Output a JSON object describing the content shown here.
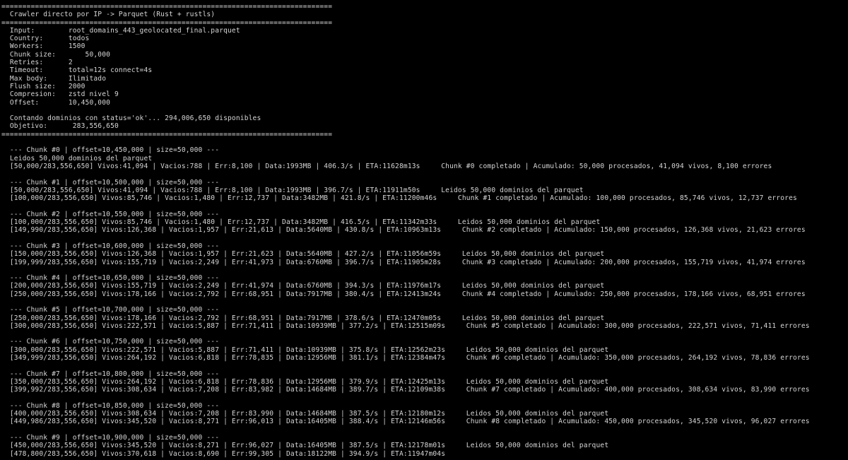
{
  "terminal": {
    "lines": [
      "===============================================================================",
      "  Crawler directo por IP -> Parquet (Rust + rustls)",
      "===============================================================================",
      "  Input:        root_domains_443_geolocated_final.parquet",
      "  Country:      todos",
      "  Workers:      1500",
      "  Chunk size:       50,000",
      "  Retries:      2",
      "  Timeout:      total=12s connect=4s",
      "  Max body:     Ilimitado",
      "  Flush size:   2000",
      "  Compresion:   zstd nivel 9",
      "  Offset:       10,450,000",
      "",
      "  Contando dominios con status='ok'... 294,006,650 disponibles",
      "  Objetivo:      283,556,650",
      "===============================================================================",
      "",
      "  --- Chunk #0 | offset=10,450,000 | size=50,000 ---",
      "  Leidos 50,000 dominios del parquet",
      "  [50,000/283,556,650] Vivos:41,094 | Vacios:788 | Err:8,100 | Data:1993MB | 406.3/s | ETA:11628m13s     Chunk #0 completado | Acumulado: 50,000 procesados, 41,094 vivos, 8,100 errores",
      "",
      "  --- Chunk #1 | offset=10,500,000 | size=50,000 ---",
      "  [50,000/283,556,650] Vivos:41,094 | Vacios:788 | Err:8,100 | Data:1993MB | 396.7/s | ETA:11911m50s     Leidos 50,000 dominios del parquet",
      "  [100,000/283,556,650] Vivos:85,746 | Vacios:1,480 | Err:12,737 | Data:3482MB | 421.8/s | ETA:11200m46s     Chunk #1 completado | Acumulado: 100,000 procesados, 85,746 vivos, 12,737 errores",
      "",
      "  --- Chunk #2 | offset=10,550,000 | size=50,000 ---",
      "  [100,000/283,556,650] Vivos:85,746 | Vacios:1,480 | Err:12,737 | Data:3482MB | 416.5/s | ETA:11342m33s     Leidos 50,000 dominios del parquet",
      "  [149,990/283,556,650] Vivos:126,368 | Vacios:1,957 | Err:21,613 | Data:5640MB | 430.8/s | ETA:10963m13s     Chunk #2 completado | Acumulado: 150,000 procesados, 126,368 vivos, 21,623 errores",
      "",
      "  --- Chunk #3 | offset=10,600,000 | size=50,000 ---",
      "  [150,000/283,556,650] Vivos:126,368 | Vacios:1,957 | Err:21,623 | Data:5640MB | 427.2/s | ETA:11056m59s     Leidos 50,000 dominios del parquet",
      "  [199,999/283,556,650] Vivos:155,719 | Vacios:2,249 | Err:41,973 | Data:6760MB | 396.7/s | ETA:11905m28s     Chunk #3 completado | Acumulado: 200,000 procesados, 155,719 vivos, 41,974 errores",
      "",
      "  --- Chunk #4 | offset=10,650,000 | size=50,000 ---",
      "  [200,000/283,556,650] Vivos:155,719 | Vacios:2,249 | Err:41,974 | Data:6760MB | 394.3/s | ETA:11976m17s     Leidos 50,000 dominios del parquet",
      "  [250,000/283,556,650] Vivos:178,166 | Vacios:2,792 | Err:68,951 | Data:7917MB | 380.4/s | ETA:12413m24s     Chunk #4 completado | Acumulado: 250,000 procesados, 178,166 vivos, 68,951 errores",
      "",
      "  --- Chunk #5 | offset=10,700,000 | size=50,000 ---",
      "  [250,000/283,556,650] Vivos:178,166 | Vacios:2,792 | Err:68,951 | Data:7917MB | 378.6/s | ETA:12470m05s     Leidos 50,000 dominios del parquet",
      "  [300,000/283,556,650] Vivos:222,571 | Vacios:5,887 | Err:71,411 | Data:10939MB | 377.2/s | ETA:12515m09s     Chunk #5 completado | Acumulado: 300,000 procesados, 222,571 vivos, 71,411 errores",
      "",
      "  --- Chunk #6 | offset=10,750,000 | size=50,000 ---",
      "  [300,000/283,556,650] Vivos:222,571 | Vacios:5,887 | Err:71,411 | Data:10939MB | 375.8/s | ETA:12562m23s     Leidos 50,000 dominios del parquet",
      "  [349,999/283,556,650] Vivos:264,192 | Vacios:6,818 | Err:78,835 | Data:12956MB | 381.1/s | ETA:12384m47s     Chunk #6 completado | Acumulado: 350,000 procesados, 264,192 vivos, 78,836 errores",
      "",
      "  --- Chunk #7 | offset=10,800,000 | size=50,000 ---",
      "  [350,000/283,556,650] Vivos:264,192 | Vacios:6,818 | Err:78,836 | Data:12956MB | 379.9/s | ETA:12425m13s     Leidos 50,000 dominios del parquet",
      "  [399,992/283,556,650] Vivos:308,634 | Vacios:7,208 | Err:83,982 | Data:14684MB | 389.7/s | ETA:12109m38s     Chunk #7 completado | Acumulado: 400,000 procesados, 308,634 vivos, 83,990 errores",
      "",
      "  --- Chunk #8 | offset=10,850,000 | size=50,000 ---",
      "  [400,000/283,556,650] Vivos:308,634 | Vacios:7,208 | Err:83,990 | Data:14684MB | 387.5/s | ETA:12180m12s     Leidos 50,000 dominios del parquet",
      "  [449,986/283,556,650] Vivos:345,520 | Vacios:8,271 | Err:96,013 | Data:16405MB | 388.4/s | ETA:12146m56s     Chunk #8 completado | Acumulado: 450,000 procesados, 345,520 vivos, 96,027 errores",
      "",
      "  --- Chunk #9 | offset=10,900,000 | size=50,000 ---",
      "  [450,000/283,556,650] Vivos:345,520 | Vacios:8,271 | Err:96,027 | Data:16405MB | 387.5/s | ETA:12178m01s     Leidos 50,000 dominios del parquet",
      "  [478,800/283,556,650] Vivos:370,618 | Vacios:8,690 | Err:99,305 | Data:18122MB | 394.9/s | ETA:11947m04s"
    ]
  }
}
